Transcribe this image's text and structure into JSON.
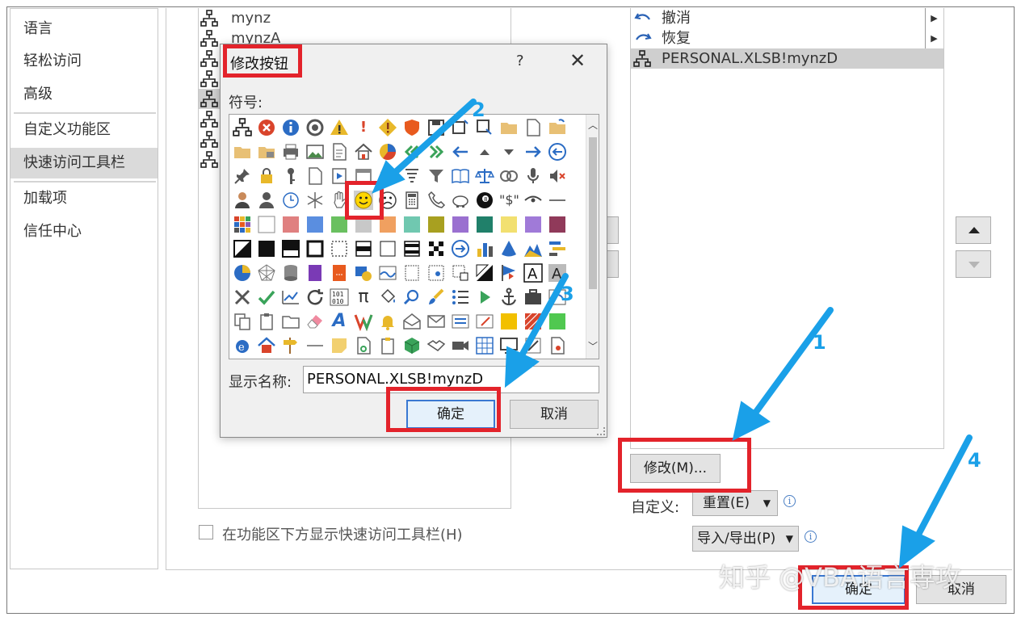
{
  "nav": {
    "items": [
      "语言",
      "轻松访问",
      "高级",
      "自定义功能区",
      "快速访问工具栏",
      "加载项",
      "信任中心"
    ]
  },
  "commands": [
    "mynz",
    "mynzA"
  ],
  "quick_access": {
    "items": [
      {
        "label": "撤消",
        "icon": "undo-icon"
      },
      {
        "label": "恢复",
        "icon": "redo-icon"
      },
      {
        "label": "PERSONAL.XLSB!mynzD",
        "icon": "macro-icon"
      }
    ]
  },
  "buttons": {
    "modify": "修改(M)...",
    "reset": "重置(E)",
    "import_export": "导入/导出(P)",
    "ok": "确定",
    "cancel": "取消"
  },
  "labels": {
    "customize": "自定义:",
    "show_below": "在功能区下方显示快速访问工具栏(H)"
  },
  "dialog": {
    "title": "修改按钮",
    "help": "?",
    "close": "✕",
    "symbol_label": "符号:",
    "display_name_label": "显示名称:",
    "display_name_value": "PERSONAL.XLSB!mynzD",
    "ok": "确定",
    "cancel": "取消"
  },
  "annotations": [
    "1",
    "2",
    "3",
    "4"
  ],
  "watermark": "知乎 @VBA语言専攻",
  "colors": {
    "highlight": "#e3232b",
    "arrow": "#1aa0e8",
    "selected": "#dadada"
  }
}
